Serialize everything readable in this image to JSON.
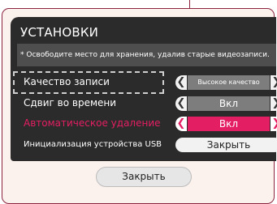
{
  "dialog": {
    "title": "УСТАНОВКИ",
    "notice": "* Освободите место для хранения, удалив старые видеозаписи."
  },
  "settings": [
    {
      "label": "Качество записи",
      "value": "Высокое качество"
    },
    {
      "label": "Сдвиг во времени",
      "value": "Вкл"
    },
    {
      "label": "Автоматическое удаление",
      "value": "Вкл"
    }
  ],
  "usb": {
    "label": "Инициализация устройства USB",
    "button": "Закрыть"
  },
  "footer": {
    "close_label": "Закрыть"
  },
  "colors": {
    "accent": "#e41e63",
    "frame": "#8c2440",
    "dialog_bg": "#2b2b2b"
  },
  "icons": {
    "prev": "chevron-left-icon",
    "next": "chevron-right-icon"
  }
}
